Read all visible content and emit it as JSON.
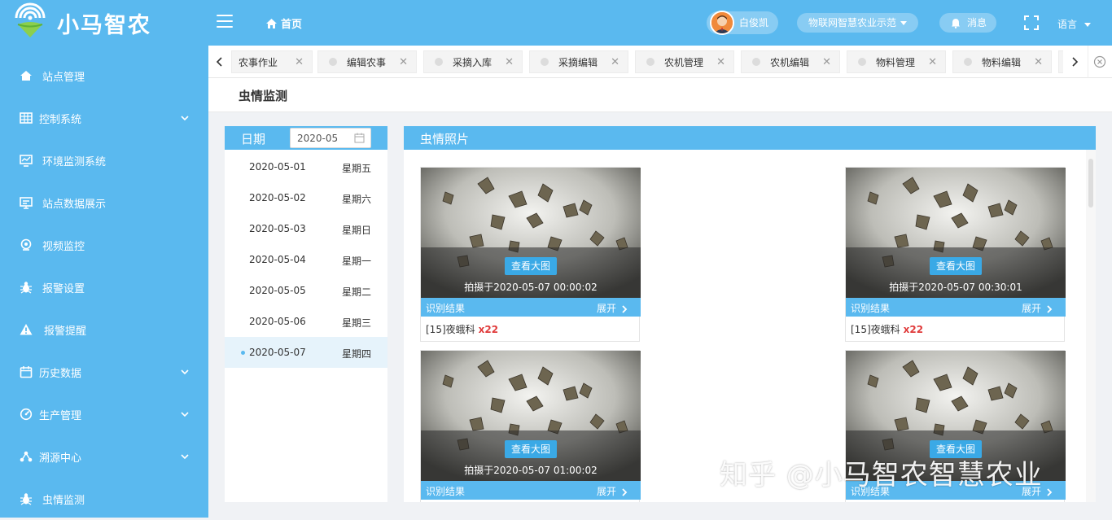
{
  "app": {
    "brand": "小马智农"
  },
  "header": {
    "home_label": "首页",
    "user_name": "白俊凯",
    "project": "物联网智慧农业示范",
    "messages_label": "消息",
    "language_label": "语言"
  },
  "sidebar": {
    "items": [
      {
        "label": "站点管理",
        "icon": "home-icon",
        "has_submenu": false
      },
      {
        "label": "控制系统",
        "icon": "grid-icon",
        "has_submenu": true
      },
      {
        "label": "环境监测系统",
        "icon": "monitor-chart-icon",
        "has_submenu": false
      },
      {
        "label": "站点数据展示",
        "icon": "display-icon",
        "has_submenu": false
      },
      {
        "label": "视频监控",
        "icon": "camera-icon",
        "has_submenu": false
      },
      {
        "label": "报警设置",
        "icon": "bug-icon",
        "has_submenu": false
      },
      {
        "label": "报警提醒",
        "icon": "warning-icon",
        "has_submenu": false
      },
      {
        "label": "历史数据",
        "icon": "history-icon",
        "has_submenu": true
      },
      {
        "label": "生产管理",
        "icon": "gauge-icon",
        "has_submenu": true
      },
      {
        "label": "溯源中心",
        "icon": "nodes-icon",
        "has_submenu": true
      },
      {
        "label": "虫情监测",
        "icon": "bug-icon",
        "has_submenu": false
      }
    ]
  },
  "tabs": [
    {
      "label": "农事作业"
    },
    {
      "label": "编辑农事"
    },
    {
      "label": "采摘入库"
    },
    {
      "label": "采摘编辑"
    },
    {
      "label": "农机管理"
    },
    {
      "label": "农机编辑"
    },
    {
      "label": "物料管理"
    },
    {
      "label": "物料编辑"
    }
  ],
  "page": {
    "title": "虫情监测"
  },
  "date_panel": {
    "label": "日期",
    "month_value": "2020-05",
    "dates": [
      {
        "date": "2020-05-01",
        "weekday": "星期五",
        "active": false
      },
      {
        "date": "2020-05-02",
        "weekday": "星期六",
        "active": false
      },
      {
        "date": "2020-05-03",
        "weekday": "星期日",
        "active": false
      },
      {
        "date": "2020-05-04",
        "weekday": "星期一",
        "active": false
      },
      {
        "date": "2020-05-05",
        "weekday": "星期二",
        "active": false
      },
      {
        "date": "2020-05-06",
        "weekday": "星期三",
        "active": false
      },
      {
        "date": "2020-05-07",
        "weekday": "星期四",
        "active": true
      }
    ]
  },
  "photo_panel": {
    "title": "虫情照片",
    "view_label": "查看大图",
    "result_label": "识别结果",
    "expand_label": "展开",
    "photos": [
      {
        "caption": "拍摄于2020-05-07 00:00:02",
        "species": "[15]夜蛾科",
        "count": "x22"
      },
      {
        "caption": "拍摄于2020-05-07 00:30:01",
        "species": "[15]夜蛾科",
        "count": "x22"
      },
      {
        "caption": "拍摄于2020-05-07 01:00:02",
        "species": "",
        "count": ""
      },
      {
        "caption": "",
        "species": "",
        "count": ""
      }
    ]
  },
  "watermark": "知乎 @小马智农智慧农业",
  "colors": {
    "primary": "#5ab9ef",
    "accent_red": "#e03b3b",
    "active_row": "#e6f3fb"
  }
}
